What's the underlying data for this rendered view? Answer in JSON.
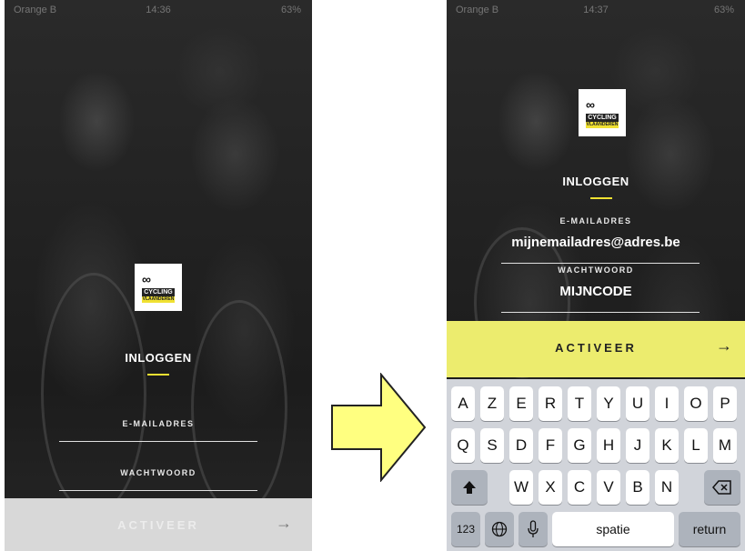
{
  "left": {
    "status": {
      "carrier": "Orange B",
      "time": "14:36",
      "battery": "63%"
    },
    "title": "INLOGGEN",
    "email_label": "E-MAILADRES",
    "password_label": "WACHTWOORD",
    "button_label": "ACTIVEER",
    "button_arrow": "→"
  },
  "right": {
    "status": {
      "carrier": "Orange B",
      "time": "14:37",
      "battery": "63%"
    },
    "title": "INLOGGEN",
    "email_label": "E-MAILADRES",
    "email_value": "mijnemailadres@adres.be",
    "password_label": "WACHTWOORD",
    "password_value": "MIJNCODE",
    "button_label": "ACTIVEER",
    "button_arrow": "→"
  },
  "logo": {
    "symbol": "∞",
    "line1": "CYCLING",
    "line2": "VLAANDEREN"
  },
  "keyboard": {
    "row1": [
      "A",
      "Z",
      "E",
      "R",
      "T",
      "Y",
      "U",
      "I",
      "O",
      "P"
    ],
    "row2": [
      "Q",
      "S",
      "D",
      "F",
      "G",
      "H",
      "J",
      "K",
      "L",
      "M"
    ],
    "row3": [
      "W",
      "X",
      "C",
      "V",
      "B",
      "N"
    ],
    "shift_icon": "shift-icon",
    "backspace_icon": "backspace-icon",
    "numbers": "123",
    "globe_icon": "globe-icon",
    "mic_icon": "microphone-icon",
    "space": "spatie",
    "return": "return"
  },
  "colors": {
    "accent_yellow": "#f0e132",
    "button_yellow": "#ecec6e",
    "arrow_fill": "#ffff80"
  }
}
